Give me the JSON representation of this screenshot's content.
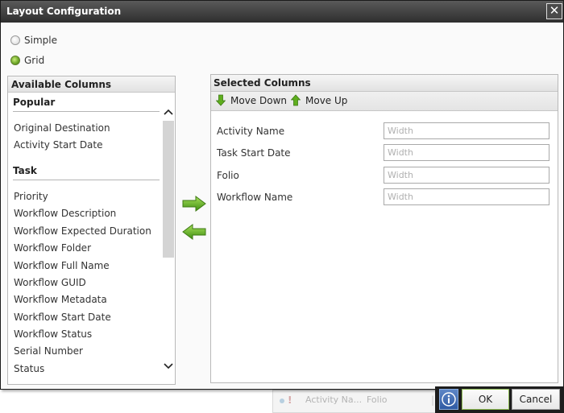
{
  "background": {
    "text1": "Activity Na...",
    "text2": "Folio",
    "bang": "!"
  },
  "dialog": {
    "title": "Layout Configuration",
    "close_glyph": "✕"
  },
  "layout_mode": {
    "options": [
      {
        "label": "Simple",
        "checked": false
      },
      {
        "label": "Grid",
        "checked": true
      }
    ]
  },
  "available": {
    "title": "Available Columns",
    "groups": [
      {
        "name": "Popular",
        "items": [
          "Original Destination",
          "Activity Start Date"
        ]
      },
      {
        "name": "Task",
        "items": [
          "Priority",
          "Workflow Description",
          "Workflow Expected Duration",
          "Workflow Folder",
          "Workflow Full Name",
          "Workflow GUID",
          "Workflow Metadata",
          "Workflow Start Date",
          "Workflow Status",
          "Serial Number",
          "Status"
        ]
      }
    ]
  },
  "transfer": {
    "add_icon": "arrow-right-icon",
    "remove_icon": "arrow-left-icon"
  },
  "selected": {
    "title": "Selected Columns",
    "toolbar": {
      "move_down": "Move Down",
      "move_up": "Move Up"
    },
    "rows": [
      {
        "name": "Activity Name",
        "width_value": "",
        "placeholder": "Width"
      },
      {
        "name": "Task Start Date",
        "width_value": "",
        "placeholder": "Width"
      },
      {
        "name": "Folio",
        "width_value": "",
        "placeholder": "Width"
      },
      {
        "name": "Workflow Name",
        "width_value": "",
        "placeholder": "Width"
      }
    ]
  },
  "footer": {
    "ok": "OK",
    "cancel": "Cancel"
  },
  "colors": {
    "accent_green": "#6aa424",
    "title_bar": "#3a3a3a",
    "info_blue": "#2f5aa3"
  }
}
